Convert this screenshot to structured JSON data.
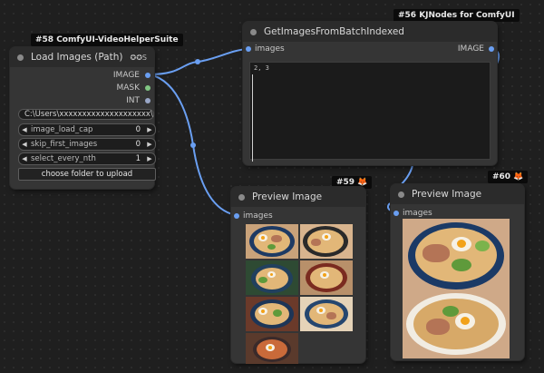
{
  "node58": {
    "badge": "#58 ComfyUI-VideoHelperSuite",
    "title": "Load Images (Path)",
    "title_icons": "✪✪S",
    "outputs": [
      "IMAGE",
      "MASK",
      "INT"
    ],
    "path_value": "C:\\Users\\xxxxxxxxxxxxxxxxxxxx\\",
    "widgets": [
      {
        "name": "image_load_cap",
        "value": "0"
      },
      {
        "name": "skip_first_images",
        "value": "0"
      },
      {
        "name": "select_every_nth",
        "value": "1"
      }
    ],
    "button_label": "choose folder to upload"
  },
  "node56": {
    "badge": "#56 KJNodes for ComfyUI",
    "title": "GetImagesFromBatchIndexed",
    "input_label": "images",
    "output_label": "IMAGE",
    "indexes_value": "2, 3"
  },
  "node59": {
    "badge": "#59",
    "badge_icon": "🦊",
    "title": "Preview Image",
    "input_label": "images",
    "thumbnail_count": 7
  },
  "node60": {
    "badge": "#60",
    "badge_icon": "🦊",
    "title": "Preview Image",
    "input_label": "images",
    "image_count": 2
  },
  "colors": {
    "image_wire": "#6a9ff2",
    "mask_dot": "#81c784",
    "int_dot": "#9aa7c8",
    "badge_accent": "#f39a2a"
  },
  "icons": {
    "collapse": "collapse-dot-icon",
    "left_arrow": "◀",
    "right_arrow": "▶"
  }
}
